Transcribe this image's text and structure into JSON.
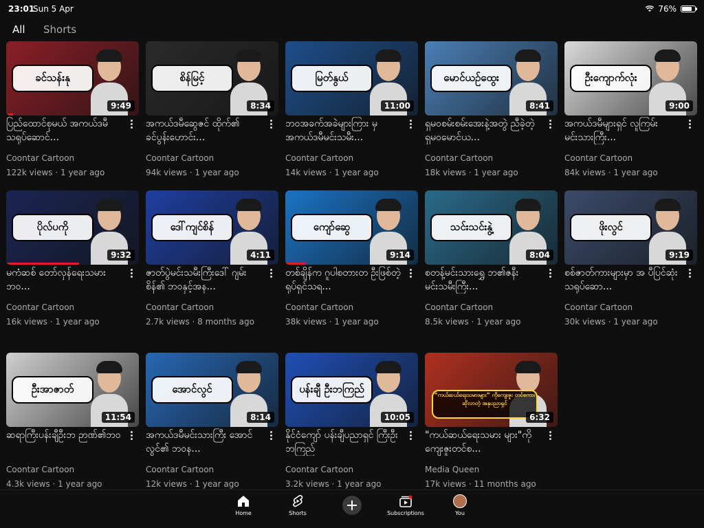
{
  "status": {
    "time": "23:01",
    "date": "Sun 5 Apr",
    "battery": "76%"
  },
  "tabs": [
    {
      "label": "All"
    },
    {
      "label": "Shorts"
    }
  ],
  "videos": [
    {
      "thumb_text": "ခင်သန်းနု",
      "duration": "9:49",
      "title": "ပြည်ထောင်စုမယ် အကယ်ဒမီသရုပ်ဆောင်...",
      "channel": "Coontar Cartoon",
      "meta": "122k views · 1 year ago",
      "bg": "#8a1f26",
      "progress": 0.05
    },
    {
      "thumb_text": "စိန်မြင့်",
      "duration": "8:34",
      "title": "အကယ်ဒမီဆွေဇင် ထိုက်၏ ခင်ပွန်းဟောင်း...",
      "channel": "Coontar Cartoon",
      "meta": "94k views · 1 year ago",
      "bg": "#2a2a2a",
      "progress": 0
    },
    {
      "thumb_text": "မြတ်နွယ်",
      "duration": "11:00",
      "title": "ဘဝအခက်အခဲများကြား မှ အကယ်ဒမီမင်းသမီး...",
      "channel": "Coontar Cartoon",
      "meta": "14k views · 1 year ago",
      "bg": "#1d4e8a",
      "progress": 0
    },
    {
      "thumb_text": "မောင်ယဉ်ထွေး",
      "duration": "8:41",
      "title": "ရှမဝစမ်းစမ်းအေးနဲ့အတွဲ ညီခဲ့တဲ့ ရှမဝမောင်ယ...",
      "channel": "Coontar Cartoon",
      "meta": "18k views · 1 year ago",
      "bg": "#4a7fb5",
      "progress": 0
    },
    {
      "thumb_text": "ဦးကျောက်လုံး",
      "duration": "9:00",
      "title": "အကယ်ဒမီများရှင် လူကြမ်းမင်းသားကြီး...",
      "channel": "Coontar Cartoon",
      "meta": "84k views · 1 year ago",
      "bg": "#d9d9d9",
      "progress": 0
    },
    {
      "thumb_text": "ပိုလ်ပကို",
      "duration": "9:32",
      "title": "မကံဆစ် တော်လှန်ရေးသမားဘဝ...",
      "channel": "Coontar Cartoon",
      "meta": "16k views · 1 year ago",
      "bg": "#1b2552",
      "progress": 0.55
    },
    {
      "thumb_text": "ဒေါ်ကျင်စိန်",
      "duration": "4:11",
      "title": "ဇာတ်ပွဲမင်းသမီးကြီးဒေါ် ဂျမ်းစိန်၏ ဘဝနှင့်အန...",
      "channel": "Coontar Cartoon",
      "meta": "2.7k views · 8 months ago",
      "bg": "#1f3fa0",
      "progress": 0
    },
    {
      "thumb_text": "ကျော်ဆွေ",
      "duration": "9:14",
      "title": "တစ်ချိန်က ဂူပါစတားတ ဦးဖြစ်တဲ့ ရုပ်ရှင်သရ...",
      "channel": "Coontar Cartoon",
      "meta": "38k views · 1 year ago",
      "bg": "#1a73c4",
      "progress": 0.15
    },
    {
      "thumb_text": "သင်းသင်းနွဲ့",
      "duration": "8:04",
      "title": "စတန့်မင်းသားရွှေ ဘ၏ဇနီး မင်းသမီးကြီး...",
      "channel": "Coontar Cartoon",
      "meta": "8.5k views · 1 year ago",
      "bg": "#2a6a8a",
      "progress": 0
    },
    {
      "thumb_text": "ဖိုးလွင်",
      "duration": "9:19",
      "title": "စစ်ဇာတ်ကားများမှာ အ ပီပြင်ဆုံးသရုပ်ဆော...",
      "channel": "Coontar Cartoon",
      "meta": "30k views · 1 year ago",
      "bg": "#3a4a6a",
      "progress": 0
    },
    {
      "thumb_text": "ဦးအာဇာတ်",
      "duration": "11:54",
      "title": "ဆရာကြီးပန်းချီဦးဘ ဉာဏ်၏ဘဝ",
      "channel": "Coontar Cartoon",
      "meta": "4.3k views · 1 year ago",
      "bg": "#cfcfcf",
      "progress": 0
    },
    {
      "thumb_text": "အောင်လွင်",
      "duration": "8:14",
      "title": "အကယ်ဒမီမင်းသားကြီး အောင်လွင်၏ ဘဝန...",
      "channel": "Coontar Cartoon",
      "meta": "12k views · 1 year ago",
      "bg": "#2767b3",
      "progress": 0
    },
    {
      "thumb_text": "ပန်းချီ ဦးဘကြည်",
      "duration": "10:05",
      "title": "နိုင်ငံကျော် ပန်းချီပညာရှင် ကြီးဦးဘကြည်",
      "channel": "Coontar Cartoon",
      "meta": "3.2k views · 1 year ago",
      "bg": "#1f4fb5",
      "progress": 0
    },
    {
      "thumb_text": "“ကယ်ဆယ်ရေးသမားများ” ကိုကျေးဇူး တင်စကားဆိုလာတဲ့ အနုပညာရှင်",
      "duration": "6:32",
      "title": "\"ကယ်ဆယ်ရေးသမား များ\"ကို ကျေးဇူးတင်စ...",
      "channel": "Media Queen",
      "meta": "17k views · 11 months ago",
      "bg": "#b03020",
      "progress": 0
    }
  ],
  "nav": [
    {
      "label": "Home",
      "icon": "home-icon"
    },
    {
      "label": "Shorts",
      "icon": "shorts-icon"
    },
    {
      "label": "Create",
      "icon": "plus-icon"
    },
    {
      "label": "Subscriptions",
      "icon": "subscriptions-icon"
    },
    {
      "label": "You",
      "icon": "avatar"
    }
  ]
}
